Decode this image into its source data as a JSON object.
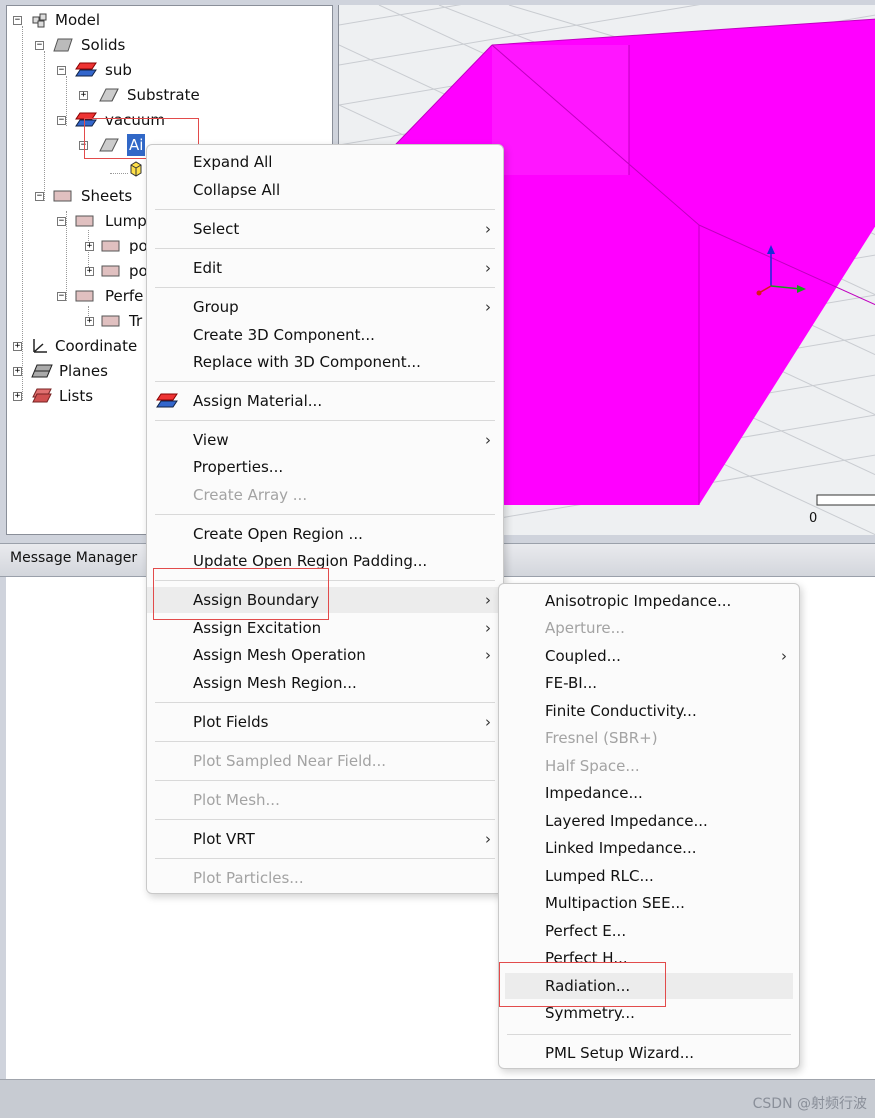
{
  "tree": {
    "model": "Model",
    "solids": "Solids",
    "sub": "sub",
    "substrate": "Substrate",
    "vacuum": "vacuum",
    "air": "Ai",
    "sheets": "Sheets",
    "lump": "Lump",
    "po1": "po",
    "po2": "po",
    "perfe": "Perfe",
    "tr": "Tr",
    "coordinate": "Coordinate",
    "planes": "Planes",
    "lists": "Lists"
  },
  "view": {
    "scale_label": "0",
    "object_color": "#ff00ff"
  },
  "message_manager": {
    "title": "Message Manager"
  },
  "context_menu": {
    "items": [
      {
        "label": "Expand All"
      },
      {
        "label": "Collapse All"
      },
      {
        "label": "Select"
      },
      {
        "label": "Edit"
      },
      {
        "label": "Group"
      },
      {
        "label": "Create 3D Component..."
      },
      {
        "label": "Replace with 3D Component..."
      },
      {
        "label": "Assign Material..."
      },
      {
        "label": "View"
      },
      {
        "label": "Properties..."
      },
      {
        "label": "Create Array ..."
      },
      {
        "label": "Create Open Region ..."
      },
      {
        "label": "Update Open Region Padding..."
      },
      {
        "label": "Assign Boundary"
      },
      {
        "label": "Assign Excitation"
      },
      {
        "label": "Assign Mesh Operation"
      },
      {
        "label": "Assign Mesh Region..."
      },
      {
        "label": "Plot Fields"
      },
      {
        "label": "Plot Sampled Near Field..."
      },
      {
        "label": "Plot Mesh..."
      },
      {
        "label": "Plot VRT"
      },
      {
        "label": "Plot Particles..."
      }
    ]
  },
  "boundary_menu": {
    "items": [
      {
        "label": "Anisotropic Impedance..."
      },
      {
        "label": "Aperture..."
      },
      {
        "label": "Coupled..."
      },
      {
        "label": "FE-BI..."
      },
      {
        "label": "Finite Conductivity..."
      },
      {
        "label": "Fresnel (SBR+)"
      },
      {
        "label": "Half Space..."
      },
      {
        "label": "Impedance..."
      },
      {
        "label": "Layered Impedance..."
      },
      {
        "label": "Linked Impedance..."
      },
      {
        "label": "Lumped RLC..."
      },
      {
        "label": "Multipaction SEE..."
      },
      {
        "label": "Perfect E..."
      },
      {
        "label": "Perfect H..."
      },
      {
        "label": "Radiation..."
      },
      {
        "label": "Symmetry..."
      },
      {
        "label": "PML Setup Wizard..."
      }
    ]
  },
  "watermark": "CSDN @射频行波"
}
